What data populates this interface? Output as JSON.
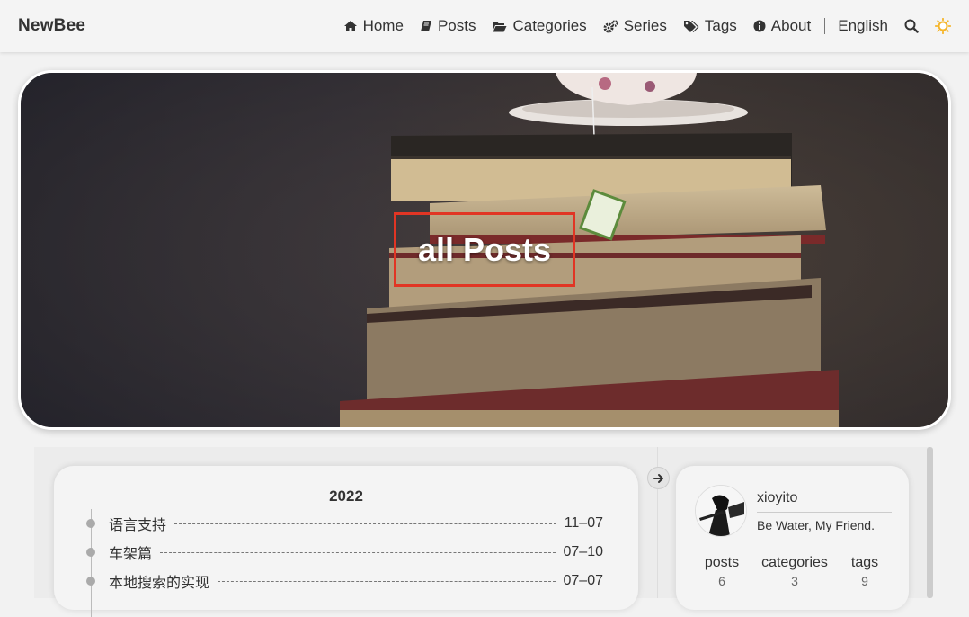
{
  "brand": "NewBee",
  "nav": {
    "items": [
      {
        "label": "Home",
        "icon": "home-icon"
      },
      {
        "label": "Posts",
        "icon": "book-icon"
      },
      {
        "label": "Categories",
        "icon": "folder-open-icon"
      },
      {
        "label": "Series",
        "icon": "gears-icon"
      },
      {
        "label": "Tags",
        "icon": "tags-icon"
      },
      {
        "label": "About",
        "icon": "info-icon"
      }
    ],
    "language": "English",
    "search_icon": "search-icon",
    "theme_icon": "sun-icon"
  },
  "hero": {
    "title": "all Posts"
  },
  "archive": {
    "year": "2022",
    "posts": [
      {
        "title": "语言支持",
        "date": "11–07"
      },
      {
        "title": "车架篇",
        "date": "07–10"
      },
      {
        "title": "本地搜索的实现",
        "date": "07–07"
      }
    ]
  },
  "profile": {
    "name": "xioyito",
    "motto": "Be Water, My Friend.",
    "stats": [
      {
        "label": "posts",
        "value": "6"
      },
      {
        "label": "categories",
        "value": "3"
      },
      {
        "label": "tags",
        "value": "9"
      }
    ]
  },
  "colors": {
    "accent_border": "#e13524",
    "theme_icon": "#f5b52a"
  }
}
